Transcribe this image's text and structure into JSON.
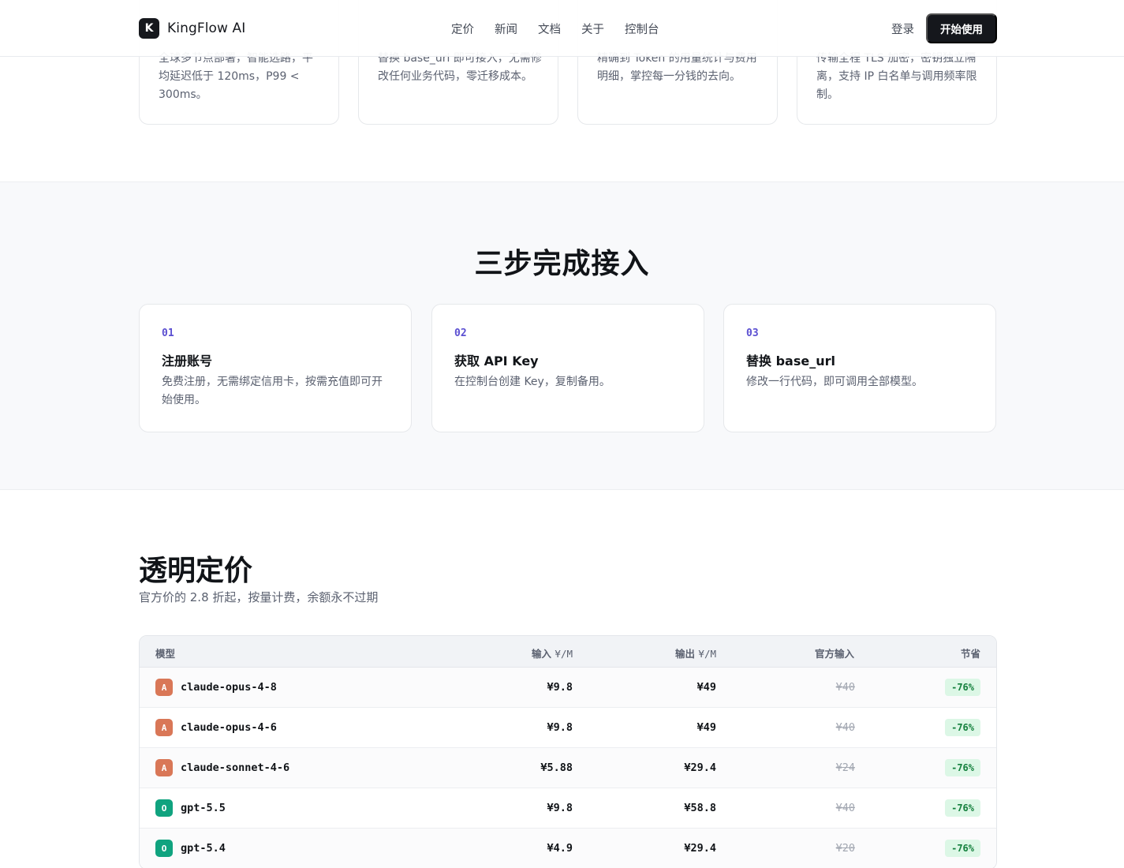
{
  "header": {
    "logo_mark": "K",
    "brand": "KingFlow AI",
    "nav": [
      "定价",
      "新闻",
      "文档",
      "关于",
      "控制台"
    ],
    "login": "登录",
    "cta": "开始使用"
  },
  "features": [
    {
      "desc": "全球多节点部署，智能选路，平均延迟低于 120ms，P99 < 300ms。"
    },
    {
      "desc": "替换 base_url 即可接入，无需修改任何业务代码，零迁移成本。"
    },
    {
      "desc": "精确到 Token 的用量统计与费用明细，掌控每一分钱的去向。"
    },
    {
      "desc": "传输全程 TLS 加密，密钥独立隔离，支持 IP 白名单与调用频率限制。"
    }
  ],
  "steps": {
    "title": "三步完成接入",
    "items": [
      {
        "num": "01",
        "title": "注册账号",
        "desc": "免费注册，无需绑定信用卡，按需充值即可开始使用。"
      },
      {
        "num": "02",
        "title": "获取 API Key",
        "desc": "在控制台创建 Key，复制备用。"
      },
      {
        "num": "03",
        "title": "替换 base_url",
        "desc": "修改一行代码，即可调用全部模型。"
      }
    ]
  },
  "pricing": {
    "title": "透明定价",
    "subtitle": "官方价的 2.8 折起，按量计费，余额永不过期",
    "columns": {
      "model": "模型",
      "input": "输入",
      "input_unit": "¥/M",
      "output": "输出",
      "output_unit": "¥/M",
      "official": "官方输入",
      "save": "节省"
    },
    "rows": [
      {
        "badge": "A",
        "badge_color": "#d97757",
        "model": "claude-opus-4-8",
        "input": "¥9.8",
        "output": "¥49",
        "official": "¥40",
        "save": "-76%"
      },
      {
        "badge": "A",
        "badge_color": "#d97757",
        "model": "claude-opus-4-6",
        "input": "¥9.8",
        "output": "¥49",
        "official": "¥40",
        "save": "-76%"
      },
      {
        "badge": "A",
        "badge_color": "#d97757",
        "model": "claude-sonnet-4-6",
        "input": "¥5.88",
        "output": "¥29.4",
        "official": "¥24",
        "save": "-76%"
      },
      {
        "badge": "O",
        "badge_color": "#10a37f",
        "model": "gpt-5.5",
        "input": "¥9.8",
        "output": "¥58.8",
        "official": "¥40",
        "save": "-76%"
      },
      {
        "badge": "O",
        "badge_color": "#10a37f",
        "model": "gpt-5.4",
        "input": "¥4.9",
        "output": "¥29.4",
        "official": "¥20",
        "save": "-76%"
      }
    ]
  }
}
